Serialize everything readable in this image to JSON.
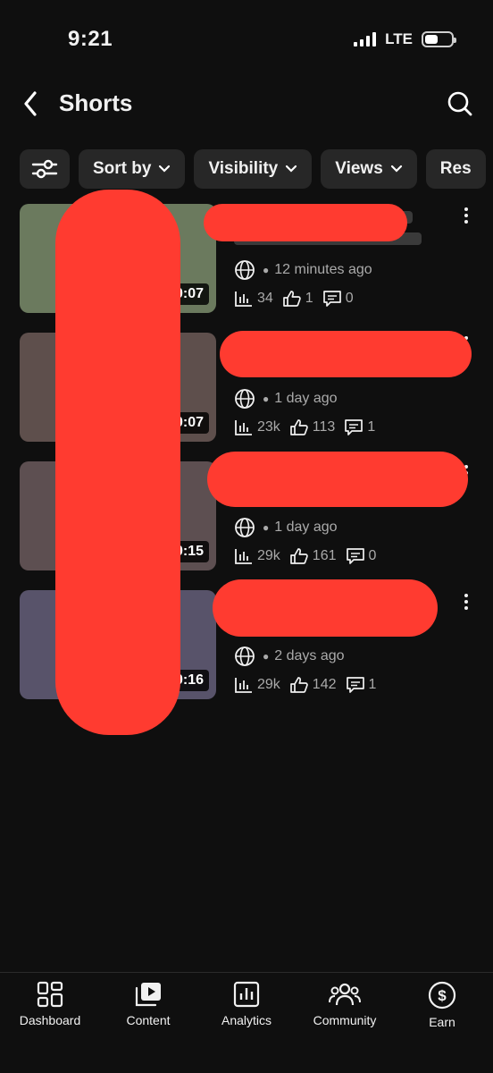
{
  "status_bar": {
    "time": "9:21",
    "network": "LTE"
  },
  "header": {
    "title": "Shorts"
  },
  "filters": [
    {
      "label": "Sort by"
    },
    {
      "label": "Visibility"
    },
    {
      "label": "Views"
    },
    {
      "label": "Res"
    }
  ],
  "videos": [
    {
      "duration": "0:07",
      "time_ago": "12 minutes ago",
      "views": "34",
      "likes": "1",
      "comments": "0",
      "thumb_color": "#6b7a5e"
    },
    {
      "duration": "0:07",
      "time_ago": "1 day ago",
      "views": "23k",
      "likes": "113",
      "comments": "1",
      "thumb_color": "#5e4f4c"
    },
    {
      "duration": "0:15",
      "time_ago": "1 day ago",
      "views": "29k",
      "likes": "161",
      "comments": "0",
      "thumb_color": "#5d4f51"
    },
    {
      "duration": "0:16",
      "time_ago": "2 days ago",
      "views": "29k",
      "likes": "142",
      "comments": "1",
      "thumb_color": "#58536a"
    }
  ],
  "bottom_nav": [
    {
      "label": "Dashboard",
      "icon": "dashboard-icon"
    },
    {
      "label": "Content",
      "icon": "content-icon"
    },
    {
      "label": "Analytics",
      "icon": "analytics-icon"
    },
    {
      "label": "Community",
      "icon": "community-icon"
    },
    {
      "label": "Earn",
      "icon": "earn-icon"
    }
  ],
  "colors": {
    "background": "#0f0f0f",
    "chip": "#272727",
    "secondary_text": "#aaaaaa",
    "redaction": "#ff3b30"
  }
}
